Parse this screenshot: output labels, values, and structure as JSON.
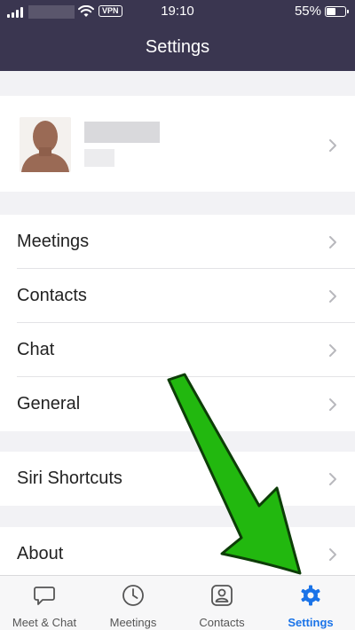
{
  "status_bar": {
    "vpn": "VPN",
    "time": "19:10",
    "battery_percent": "55%",
    "battery_level": 0.55,
    "wifi_icon": "wifi-icon",
    "signal_icon": "cellular-signal-icon"
  },
  "header": {
    "title": "Settings"
  },
  "menu": [
    {
      "label": "Meetings",
      "icon": "chevron-right-icon"
    },
    {
      "label": "Contacts",
      "icon": "chevron-right-icon"
    },
    {
      "label": "Chat",
      "icon": "chevron-right-icon"
    },
    {
      "label": "General",
      "icon": "chevron-right-icon"
    },
    {
      "label": "Siri Shortcuts",
      "icon": "chevron-right-icon"
    },
    {
      "label": "About",
      "icon": "chevron-right-icon"
    }
  ],
  "tab_bar": {
    "tabs": [
      {
        "label": "Meet & Chat",
        "icon": "chat-bubble-icon"
      },
      {
        "label": "Meetings",
        "icon": "clock-icon"
      },
      {
        "label": "Contacts",
        "icon": "contact-card-icon"
      },
      {
        "label": "Settings",
        "icon": "gear-icon",
        "active": true
      }
    ]
  },
  "colors": {
    "header_bg": "#3a3650",
    "accent_blue": "#1a73e8",
    "arrow_green": "#22b80f",
    "page_bg": "#f2f2f5"
  }
}
